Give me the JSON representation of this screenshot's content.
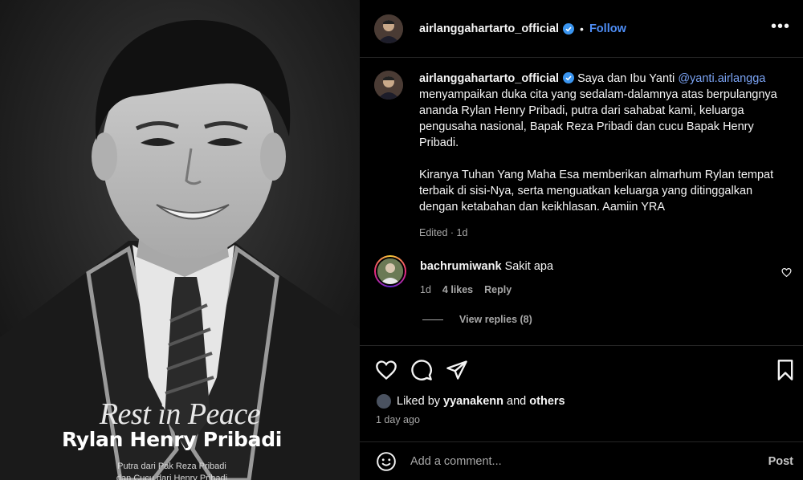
{
  "photo": {
    "title": "Rest in Peace",
    "name": "Rylan Henry Pribadi",
    "subtitle_line1": "Putra dari Pak Reza Pribadi",
    "subtitle_line2": "dan Cucu dari Henry Pribadi"
  },
  "header": {
    "username": "airlanggahartarto_official",
    "separator": "•",
    "follow_label": "Follow",
    "more_label": "•••"
  },
  "caption": {
    "username": "airlanggahartarto_official",
    "text_before_mention": " Saya dan Ibu Yanti ",
    "mention": "@yanti.airlangga",
    "text_after_mention": " menyampaikan duka cita yang sedalam-dalamnya atas berpulangnya ananda Rylan Henry Pribadi, putra dari sahabat kami, keluarga pengusaha nasional, Bapak Reza Pribadi dan cucu Bapak Henry Pribadi.",
    "paragraph2": "Kiranya Tuhan Yang Maha Esa memberikan almarhum Rylan tempat terbaik di sisi-Nya, serta menguatkan keluarga yang ditinggalkan dengan ketabahan dan keikhlasan. Aamiin YRA",
    "meta": "Edited · 1d"
  },
  "comment": {
    "username": "bachrumiwank",
    "text": "Sakit apa",
    "time": "1d",
    "likes": "4 likes",
    "reply_label": "Reply",
    "view_replies": "View replies (8)"
  },
  "likes": {
    "prefix": "Liked by ",
    "user": "yyanakenn",
    "middle": " and ",
    "others": "others",
    "time": "1 day ago"
  },
  "add_comment": {
    "placeholder": "Add a comment...",
    "post_label": "Post"
  },
  "icons": {
    "like": "heart-icon",
    "comment": "comment-bubble-icon",
    "share": "paper-plane-icon",
    "save": "bookmark-icon",
    "emoji": "emoji-smile-icon",
    "verified": "verified-badge-icon"
  },
  "colors": {
    "background": "#000000",
    "link": "#4e8ef7",
    "mention": "#7ba4f5",
    "muted": "#a8a8a8",
    "verified": "#3a95f0"
  }
}
